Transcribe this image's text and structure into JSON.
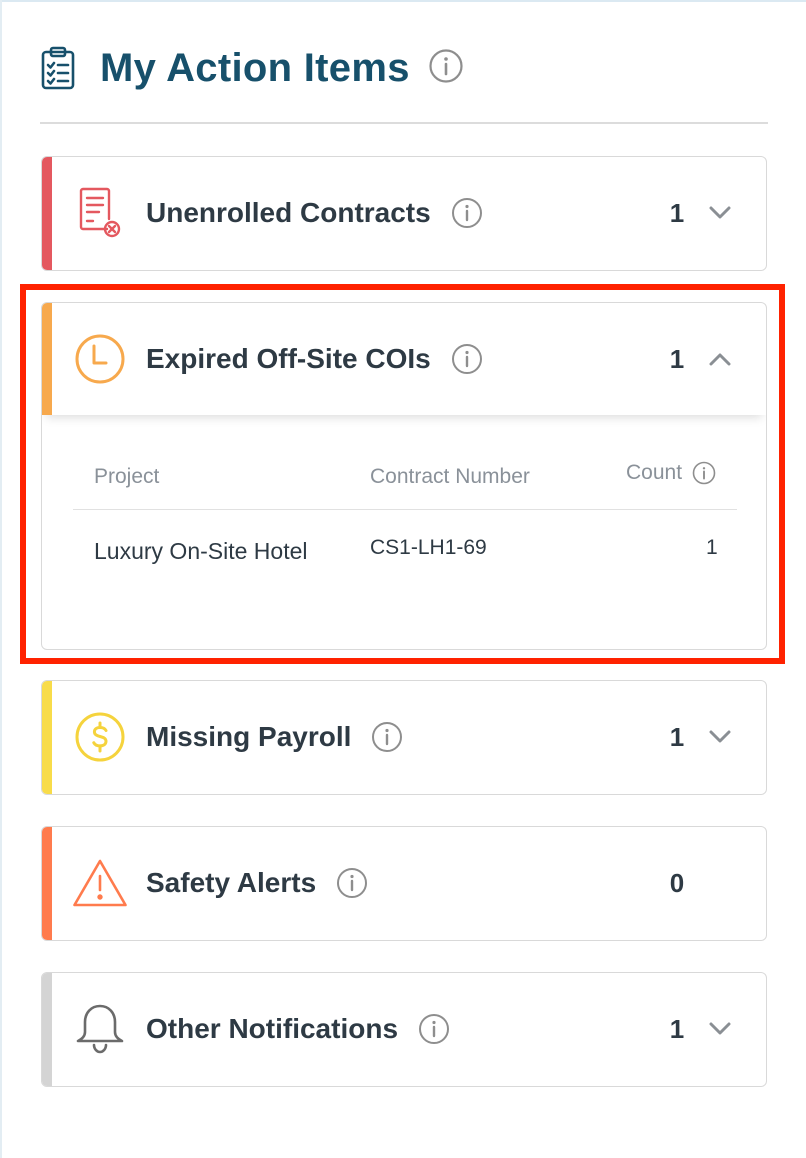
{
  "header": {
    "title": "My Action Items",
    "icon": "clipboard-checklist-icon"
  },
  "cards": [
    {
      "label": "Unenrolled Contracts",
      "count": "1",
      "state": "collapsed",
      "icon": "contract-x-icon",
      "accent": "#e4585f",
      "icon_color": "#e4585f"
    },
    {
      "label": "Expired Off-Site COIs",
      "count": "1",
      "state": "expanded",
      "icon": "clock-icon",
      "accent": "#f7a94d",
      "icon_color": "#f7a94d",
      "table": {
        "headers": {
          "project": "Project",
          "contract_number": "Contract Number",
          "count": "Count"
        },
        "rows": [
          {
            "project": "Luxury On-Site Hotel",
            "contract_number": "CS1-LH1-69",
            "count": "1"
          }
        ]
      }
    },
    {
      "label": "Missing Payroll",
      "count": "1",
      "state": "collapsed",
      "icon": "dollar-circle-icon",
      "accent": "#f8dc4a",
      "icon_color": "#f5d33d"
    },
    {
      "label": "Safety Alerts",
      "count": "0",
      "state": "no-toggle",
      "icon": "warning-triangle-icon",
      "accent": "#ff7b4d",
      "icon_color": "#ff7b4d"
    },
    {
      "label": "Other Notifications",
      "count": "1",
      "state": "collapsed",
      "icon": "bell-icon",
      "accent": "#d4d4d4",
      "icon_color": "#6b6b6b"
    }
  ],
  "colors": {
    "title": "#17506b",
    "text": "#2e3a44",
    "muted": "#8a9199",
    "highlight": "#ff2200"
  }
}
